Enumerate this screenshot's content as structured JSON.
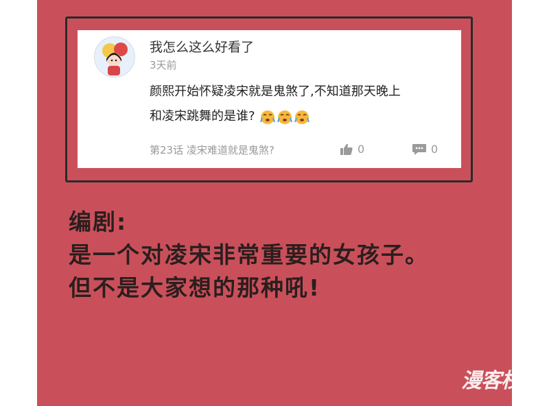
{
  "comment": {
    "username": "我怎么这么好看了",
    "time": "3天前",
    "lines": [
      "颜熙开始怀疑凌宋就是鬼煞了,不知道那天晚上",
      "和凌宋跳舞的是谁?"
    ],
    "emojis": [
      "crying-face-icon",
      "crying-face-icon",
      "crying-face-icon"
    ],
    "chapter": "第23话 凌宋难道就是鬼煞?",
    "likes": "0",
    "replies": "0"
  },
  "writer_note": {
    "lines": [
      "编剧:",
      "是一个对凌宋非常重要的女孩子。",
      "但不是大家想的那种吼!"
    ]
  },
  "watermark": "漫客栈",
  "colors": {
    "background": "#c9505a",
    "note_text": "#2b1e1e",
    "meta_text": "#999999"
  }
}
